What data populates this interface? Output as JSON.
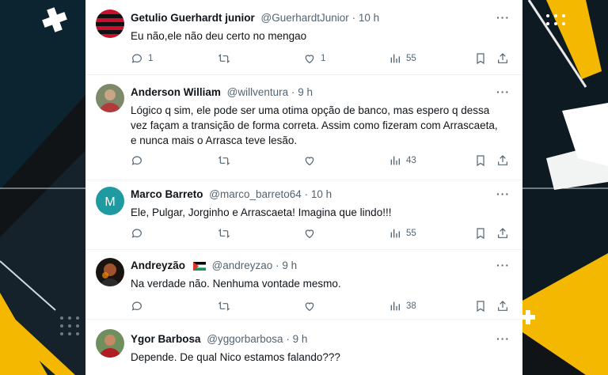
{
  "tweets": [
    {
      "name": "Getulio Guerhardt junior",
      "handle": "@GuerhardtJunior",
      "sep": "·",
      "time": "10 h",
      "text": "Eu não,ele não deu certo no mengao",
      "avatar": "flamengo-avatar",
      "replies": "1",
      "retweets": "",
      "likes": "1",
      "views": "55"
    },
    {
      "name": "Anderson William",
      "handle": "@willventura",
      "sep": "·",
      "time": "9 h",
      "text_lines": [
        "Lógico q sim, ele pode ser uma otima opção de banco, mas espero q dessa",
        "vez façam a transição de forma correta. Assim como fizeram com Arrascaeta,",
        "e nunca mais o Arrasca teve lesão."
      ],
      "avatar": "photo-avatar",
      "replies": "",
      "retweets": "",
      "likes": "",
      "views": "43"
    },
    {
      "name": "Marco Barreto",
      "handle": "@marco_barreto64",
      "sep": "·",
      "time": "10 h",
      "text": "Ele, Pulgar, Jorginho e Arrascaeta! Imagina que lindo!!!",
      "avatar_letter": "M",
      "avatar_color": "#1e9aa0",
      "replies": "",
      "retweets": "",
      "likes": "",
      "views": "55"
    },
    {
      "name": "Andreyzão",
      "handle": "@andreyzao",
      "sep": "·",
      "time": "9 h",
      "text": "Na verdade não. Nenhuma vontade mesmo.",
      "avatar": "photo-avatar",
      "replies": "",
      "retweets": "",
      "likes": "",
      "views": "38"
    },
    {
      "name": "Ygor Barbosa",
      "handle": "@yggorbarbosa",
      "sep": "·",
      "time": "9 h",
      "text": "Depende. De qual Nico estamos falando???",
      "avatar": "photo-avatar"
    }
  ],
  "more_label": "···",
  "colors": {
    "accent_yellow": "#f5b800",
    "panel": "#ffffff",
    "muted": "#536471"
  }
}
